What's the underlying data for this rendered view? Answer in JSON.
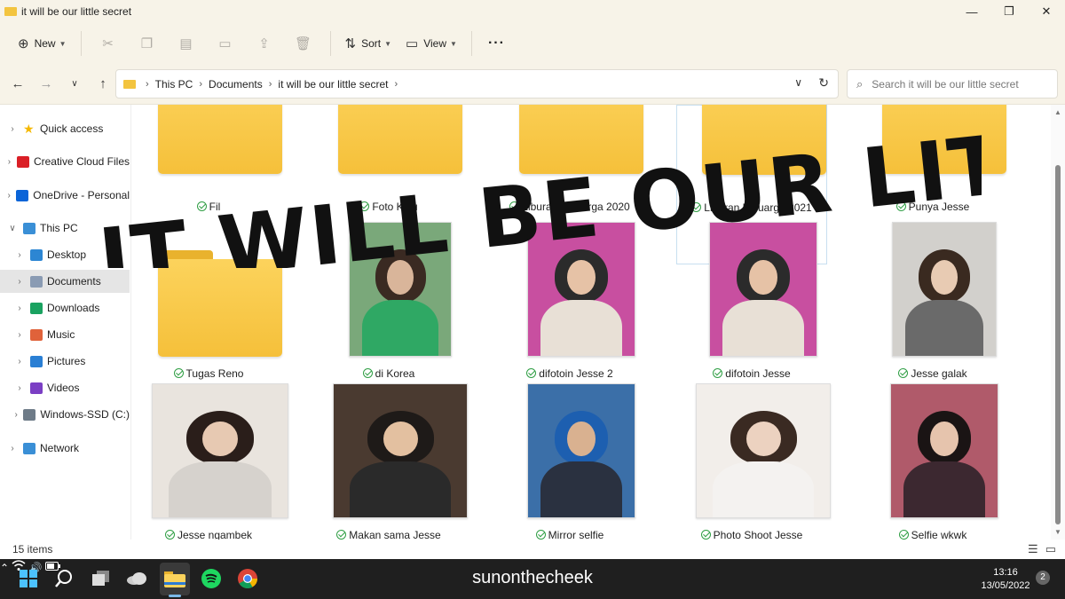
{
  "window": {
    "title": "it will be our little secret",
    "minimize": "—",
    "maximize": "❐",
    "close": "✕"
  },
  "toolbar": {
    "new_label": "New",
    "sort_label": "Sort",
    "view_label": "View",
    "more": "···",
    "icons": [
      "scissors-icon",
      "copy-icon",
      "paste-icon",
      "rename-icon",
      "share-icon",
      "delete-icon"
    ]
  },
  "address": {
    "crumbs": [
      "This PC",
      "Documents",
      "it will be our little secret"
    ],
    "search_placeholder": "Search it will be our little secret"
  },
  "sidebar": {
    "items": [
      {
        "label": "Quick access",
        "icon": "star-icon",
        "color": "#f5b800"
      },
      {
        "label": "Creative Cloud Files",
        "icon": "creative-cloud-icon",
        "color": "#da1f26"
      },
      {
        "label": "OneDrive - Personal",
        "icon": "onedrive-icon",
        "color": "#0a64d8"
      },
      {
        "label": "This PC",
        "icon": "computer-icon",
        "color": "#3a8fd6"
      },
      {
        "label": "Desktop",
        "icon": "desktop-icon",
        "color": "#2c86d3"
      },
      {
        "label": "Documents",
        "icon": "documents-icon",
        "color": "#8a9bb3"
      },
      {
        "label": "Downloads",
        "icon": "download-icon",
        "color": "#1aa260"
      },
      {
        "label": "Music",
        "icon": "music-icon",
        "color": "#e0623a"
      },
      {
        "label": "Pictures",
        "icon": "pictures-icon",
        "color": "#2a7fd4"
      },
      {
        "label": "Videos",
        "icon": "videos-icon",
        "color": "#7b3fc4"
      },
      {
        "label": "Windows-SSD (C:)",
        "icon": "drive-icon",
        "color": "#6e7b88"
      },
      {
        "label": "Network",
        "icon": "network-icon",
        "color": "#3a8fd6"
      }
    ]
  },
  "files": {
    "row1": [
      "Fil",
      "Foto Kelu",
      "Liburan Keluarga 2020",
      "Liburan Keluarga 2021",
      "Punya Jesse"
    ],
    "row2": [
      "Tugas Reno",
      "di Korea",
      "difotoin Jesse 2",
      "difotoin Jesse",
      "Jesse galak"
    ],
    "row3": [
      "Jesse ngambek",
      "Makan sama Jesse",
      "Mirror selfie",
      "Photo Shoot Jesse",
      "Selfie wkwk"
    ]
  },
  "overlay_text": "IT WILL BE OUR LITTLE SECRET",
  "status": {
    "count": "15 items"
  },
  "taskbar": {
    "caption": "sunonthecheek",
    "time": "13:16",
    "date": "13/05/2022",
    "notifications": "2"
  }
}
